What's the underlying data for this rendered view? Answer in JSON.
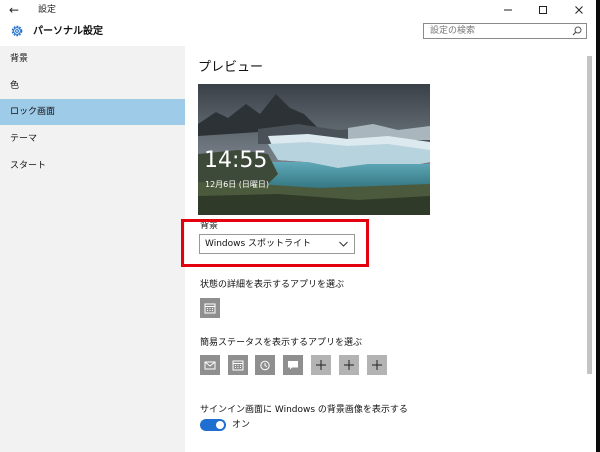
{
  "window": {
    "title": "設定"
  },
  "header": {
    "heading": "パーソナル設定",
    "search_placeholder": "設定の検索"
  },
  "sidebar": {
    "items": [
      {
        "label": "背景"
      },
      {
        "label": "色"
      },
      {
        "label": "ロック画面"
      },
      {
        "label": "テーマ"
      },
      {
        "label": "スタート"
      }
    ],
    "selected_index": 2
  },
  "main": {
    "preview_heading": "プレビュー",
    "preview": {
      "time": "14:55",
      "date": "12月6日 (日曜日)"
    },
    "background": {
      "label": "背景",
      "selected": "Windows スポットライト"
    },
    "detail_app": {
      "label": "状態の詳細を表示するアプリを選ぶ",
      "icons": [
        "calendar-icon"
      ]
    },
    "quick_apps": {
      "label": "簡易ステータスを表示するアプリを選ぶ",
      "icons": [
        "mail-icon",
        "calendar-icon",
        "alarm-icon",
        "message-icon",
        "add-icon",
        "add-icon",
        "add-icon"
      ]
    },
    "signin_background": {
      "label": "サインイン画面に Windows の背景画像を表示する",
      "state": "オン",
      "on": true
    }
  },
  "colors": {
    "accent": "#1e6fd0",
    "selection": "#9ecbe8",
    "highlight": "#e3000f"
  }
}
